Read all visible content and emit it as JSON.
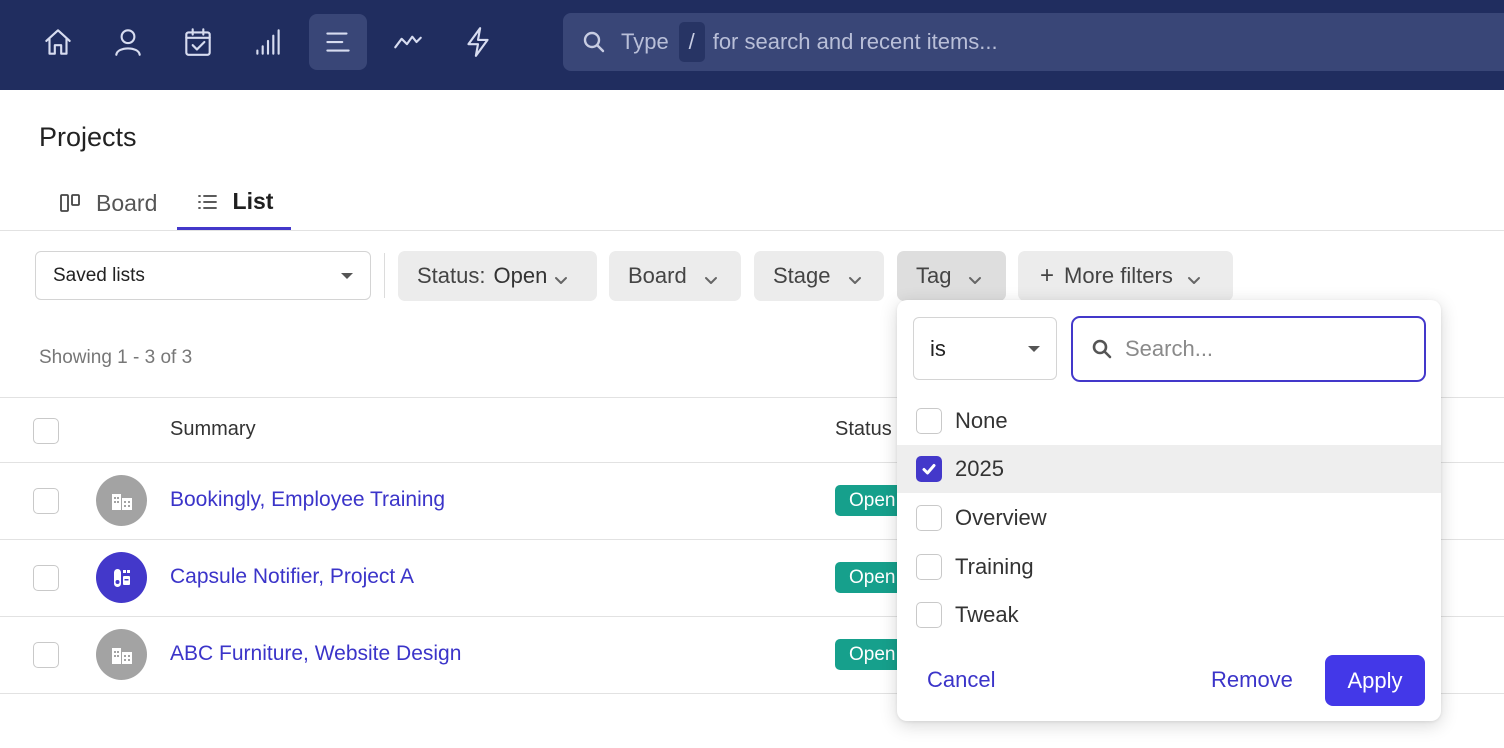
{
  "topnav": {
    "icons": [
      "home-icon",
      "user-icon",
      "calendar-icon",
      "reports-icon",
      "list-icon",
      "activity-icon",
      "lightning-icon"
    ],
    "active_icon": "list-icon",
    "search": {
      "prefix": "Type",
      "shortcut": "/",
      "suffix": "for search and recent items..."
    }
  },
  "page": {
    "title": "Projects",
    "tabs": [
      {
        "label": "Board",
        "active": false
      },
      {
        "label": "List",
        "active": true
      }
    ]
  },
  "filters": {
    "saved_lists": "Saved lists",
    "status_label": "Status:",
    "status_value": "Open",
    "board": "Board",
    "stage": "Stage",
    "tag": "Tag",
    "more": "More filters"
  },
  "showing": "Showing 1 - 3 of 3",
  "table": {
    "columns": [
      "Summary",
      "Status"
    ],
    "rows": [
      {
        "summary": "Bookingly, Employee Training",
        "status": "Open",
        "avatar": "building-icon"
      },
      {
        "summary": "Capsule Notifier, Project A",
        "status": "Open",
        "avatar": "app-icon"
      },
      {
        "summary": "ABC Furniture, Website Design",
        "status": "Open",
        "avatar": "building-icon"
      }
    ]
  },
  "tag_popover": {
    "operator": "is",
    "search_placeholder": "Search...",
    "options": [
      {
        "label": "None",
        "checked": false
      },
      {
        "label": "2025",
        "checked": true
      },
      {
        "label": "Overview",
        "checked": false
      },
      {
        "label": "Training",
        "checked": false
      },
      {
        "label": "Tweak",
        "checked": false
      }
    ],
    "cancel": "Cancel",
    "remove": "Remove",
    "apply": "Apply"
  },
  "colors": {
    "nav_bg": "#202d5f",
    "accent": "#4338ca",
    "link": "#3b34c9",
    "status_open": "#16a08c",
    "avatar_gray": "#a3a3a3",
    "avatar_brand": "#4338ca"
  }
}
